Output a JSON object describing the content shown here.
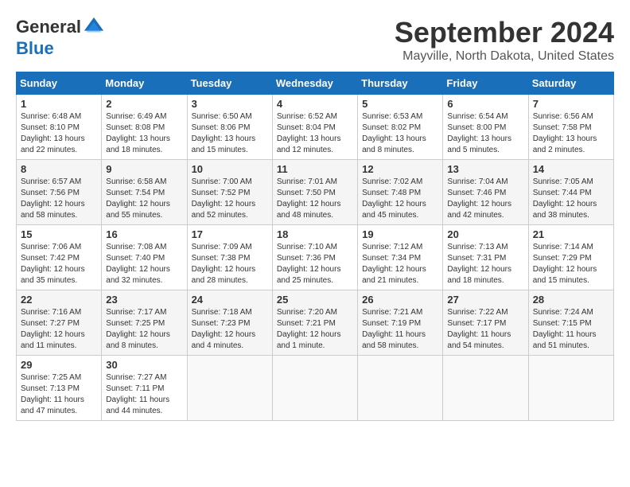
{
  "logo": {
    "general": "General",
    "blue": "Blue"
  },
  "title": "September 2024",
  "location": "Mayville, North Dakota, United States",
  "weekdays": [
    "Sunday",
    "Monday",
    "Tuesday",
    "Wednesday",
    "Thursday",
    "Friday",
    "Saturday"
  ],
  "weeks": [
    [
      {
        "day": "1",
        "sunrise": "6:48 AM",
        "sunset": "8:10 PM",
        "daylight": "13 hours and 22 minutes."
      },
      {
        "day": "2",
        "sunrise": "6:49 AM",
        "sunset": "8:08 PM",
        "daylight": "13 hours and 18 minutes."
      },
      {
        "day": "3",
        "sunrise": "6:50 AM",
        "sunset": "8:06 PM",
        "daylight": "13 hours and 15 minutes."
      },
      {
        "day": "4",
        "sunrise": "6:52 AM",
        "sunset": "8:04 PM",
        "daylight": "13 hours and 12 minutes."
      },
      {
        "day": "5",
        "sunrise": "6:53 AM",
        "sunset": "8:02 PM",
        "daylight": "13 hours and 8 minutes."
      },
      {
        "day": "6",
        "sunrise": "6:54 AM",
        "sunset": "8:00 PM",
        "daylight": "13 hours and 5 minutes."
      },
      {
        "day": "7",
        "sunrise": "6:56 AM",
        "sunset": "7:58 PM",
        "daylight": "13 hours and 2 minutes."
      }
    ],
    [
      {
        "day": "8",
        "sunrise": "6:57 AM",
        "sunset": "7:56 PM",
        "daylight": "12 hours and 58 minutes."
      },
      {
        "day": "9",
        "sunrise": "6:58 AM",
        "sunset": "7:54 PM",
        "daylight": "12 hours and 55 minutes."
      },
      {
        "day": "10",
        "sunrise": "7:00 AM",
        "sunset": "7:52 PM",
        "daylight": "12 hours and 52 minutes."
      },
      {
        "day": "11",
        "sunrise": "7:01 AM",
        "sunset": "7:50 PM",
        "daylight": "12 hours and 48 minutes."
      },
      {
        "day": "12",
        "sunrise": "7:02 AM",
        "sunset": "7:48 PM",
        "daylight": "12 hours and 45 minutes."
      },
      {
        "day": "13",
        "sunrise": "7:04 AM",
        "sunset": "7:46 PM",
        "daylight": "12 hours and 42 minutes."
      },
      {
        "day": "14",
        "sunrise": "7:05 AM",
        "sunset": "7:44 PM",
        "daylight": "12 hours and 38 minutes."
      }
    ],
    [
      {
        "day": "15",
        "sunrise": "7:06 AM",
        "sunset": "7:42 PM",
        "daylight": "12 hours and 35 minutes."
      },
      {
        "day": "16",
        "sunrise": "7:08 AM",
        "sunset": "7:40 PM",
        "daylight": "12 hours and 32 minutes."
      },
      {
        "day": "17",
        "sunrise": "7:09 AM",
        "sunset": "7:38 PM",
        "daylight": "12 hours and 28 minutes."
      },
      {
        "day": "18",
        "sunrise": "7:10 AM",
        "sunset": "7:36 PM",
        "daylight": "12 hours and 25 minutes."
      },
      {
        "day": "19",
        "sunrise": "7:12 AM",
        "sunset": "7:34 PM",
        "daylight": "12 hours and 21 minutes."
      },
      {
        "day": "20",
        "sunrise": "7:13 AM",
        "sunset": "7:31 PM",
        "daylight": "12 hours and 18 minutes."
      },
      {
        "day": "21",
        "sunrise": "7:14 AM",
        "sunset": "7:29 PM",
        "daylight": "12 hours and 15 minutes."
      }
    ],
    [
      {
        "day": "22",
        "sunrise": "7:16 AM",
        "sunset": "7:27 PM",
        "daylight": "12 hours and 11 minutes."
      },
      {
        "day": "23",
        "sunrise": "7:17 AM",
        "sunset": "7:25 PM",
        "daylight": "12 hours and 8 minutes."
      },
      {
        "day": "24",
        "sunrise": "7:18 AM",
        "sunset": "7:23 PM",
        "daylight": "12 hours and 4 minutes."
      },
      {
        "day": "25",
        "sunrise": "7:20 AM",
        "sunset": "7:21 PM",
        "daylight": "12 hours and 1 minute."
      },
      {
        "day": "26",
        "sunrise": "7:21 AM",
        "sunset": "7:19 PM",
        "daylight": "11 hours and 58 minutes."
      },
      {
        "day": "27",
        "sunrise": "7:22 AM",
        "sunset": "7:17 PM",
        "daylight": "11 hours and 54 minutes."
      },
      {
        "day": "28",
        "sunrise": "7:24 AM",
        "sunset": "7:15 PM",
        "daylight": "11 hours and 51 minutes."
      }
    ],
    [
      {
        "day": "29",
        "sunrise": "7:25 AM",
        "sunset": "7:13 PM",
        "daylight": "11 hours and 47 minutes."
      },
      {
        "day": "30",
        "sunrise": "7:27 AM",
        "sunset": "7:11 PM",
        "daylight": "11 hours and 44 minutes."
      },
      null,
      null,
      null,
      null,
      null
    ]
  ],
  "labels": {
    "sunrise": "Sunrise: ",
    "sunset": "Sunset: ",
    "daylight": "Daylight: "
  }
}
